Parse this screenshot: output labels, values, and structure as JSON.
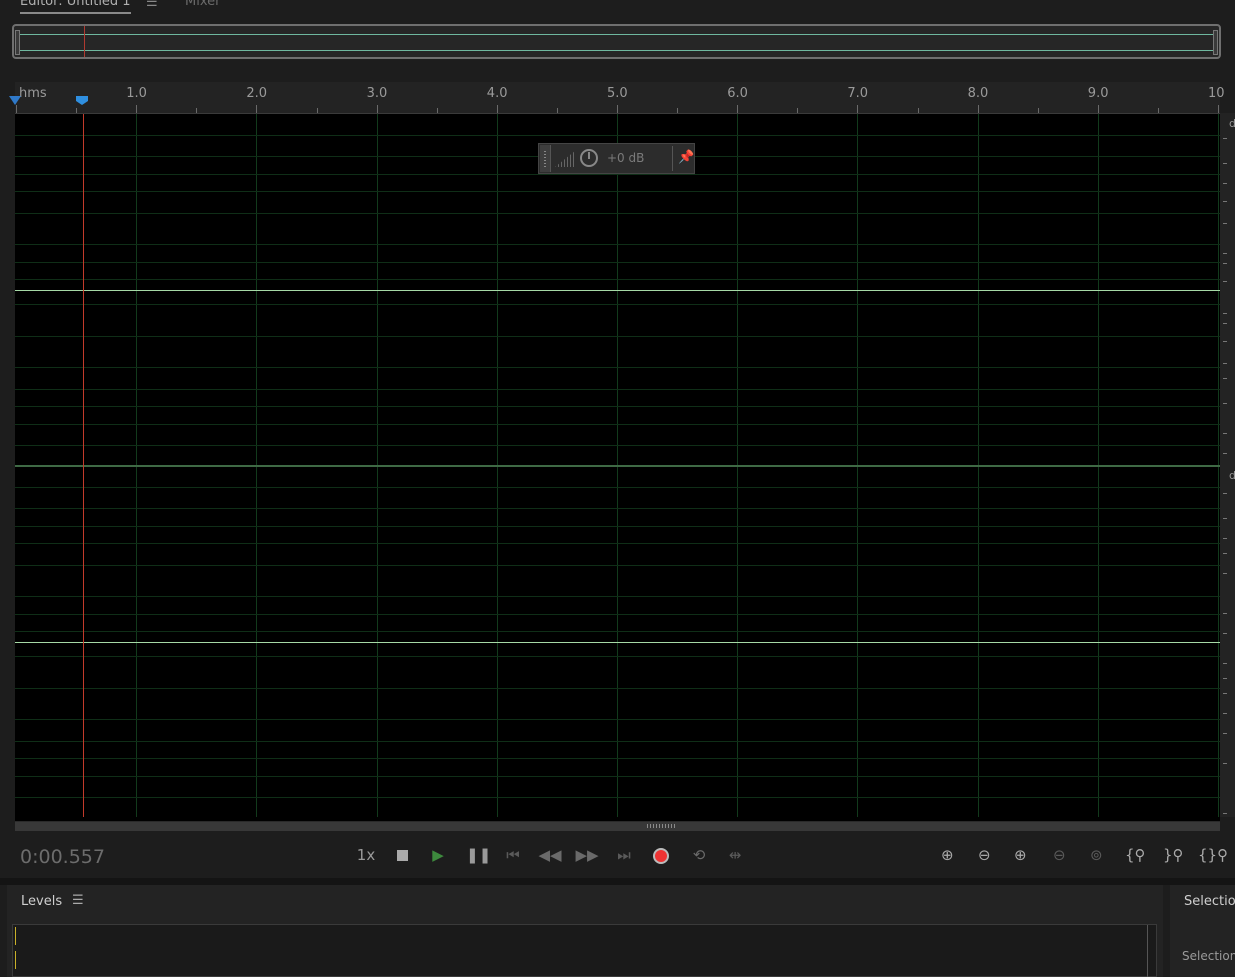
{
  "tabs": {
    "editor_label": "Editor: Untitled 1",
    "editor_menu_icon": "hamburger-icon",
    "mixer_label": "Mixer"
  },
  "ruler": {
    "unit": "hms",
    "labels": [
      "1.0",
      "2.0",
      "3.0",
      "4.0",
      "5.0",
      "6.0",
      "7.0",
      "8.0",
      "9.0",
      "10"
    ]
  },
  "waveform": {
    "channels": 2,
    "channel_label_top": "d",
    "channel_label_bottom": "d",
    "playhead_time": "0:00.557",
    "colors": {
      "background": "#000000",
      "zero_line": "#a6d9a6",
      "grid": "#123a1c",
      "playhead": "#c23a2a"
    }
  },
  "hud": {
    "volume_value": "+0 dB",
    "knob_icon": "volume-knob-icon",
    "pin_icon": "pin-icon"
  },
  "transport": {
    "timecode": "0:00.557",
    "speed": "1x",
    "buttons": [
      {
        "name": "stop",
        "icon": "stop-icon"
      },
      {
        "name": "play",
        "icon": "play-icon"
      },
      {
        "name": "pause",
        "icon": "pause-icon"
      },
      {
        "name": "go-to-start",
        "icon": "skip-back-icon"
      },
      {
        "name": "rewind",
        "icon": "rewind-icon"
      },
      {
        "name": "fast-forward",
        "icon": "fast-forward-icon"
      },
      {
        "name": "go-to-end",
        "icon": "skip-forward-icon"
      },
      {
        "name": "record",
        "icon": "record-icon"
      },
      {
        "name": "loop",
        "icon": "loop-icon"
      },
      {
        "name": "skip-selection",
        "icon": "skip-selection-icon"
      }
    ],
    "zoom_buttons": [
      {
        "name": "zoom-in-amplitude",
        "icon": "zoom-in-amplitude-icon"
      },
      {
        "name": "zoom-out-amplitude",
        "icon": "zoom-out-amplitude-icon"
      },
      {
        "name": "zoom-in-time",
        "icon": "zoom-in-time-icon"
      },
      {
        "name": "zoom-out-time",
        "icon": "zoom-out-time-icon"
      },
      {
        "name": "zoom-out-full",
        "icon": "zoom-out-full-icon"
      },
      {
        "name": "zoom-in-at-in",
        "icon": "zoom-in-point-icon"
      },
      {
        "name": "zoom-in-at-out",
        "icon": "zoom-out-point-icon"
      },
      {
        "name": "zoom-selection",
        "icon": "zoom-selection-icon"
      }
    ]
  },
  "levels_panel": {
    "title": "Levels",
    "menu_icon": "hamburger-icon"
  },
  "selection_panel": {
    "title": "Selection",
    "subtitle": "Selection"
  }
}
